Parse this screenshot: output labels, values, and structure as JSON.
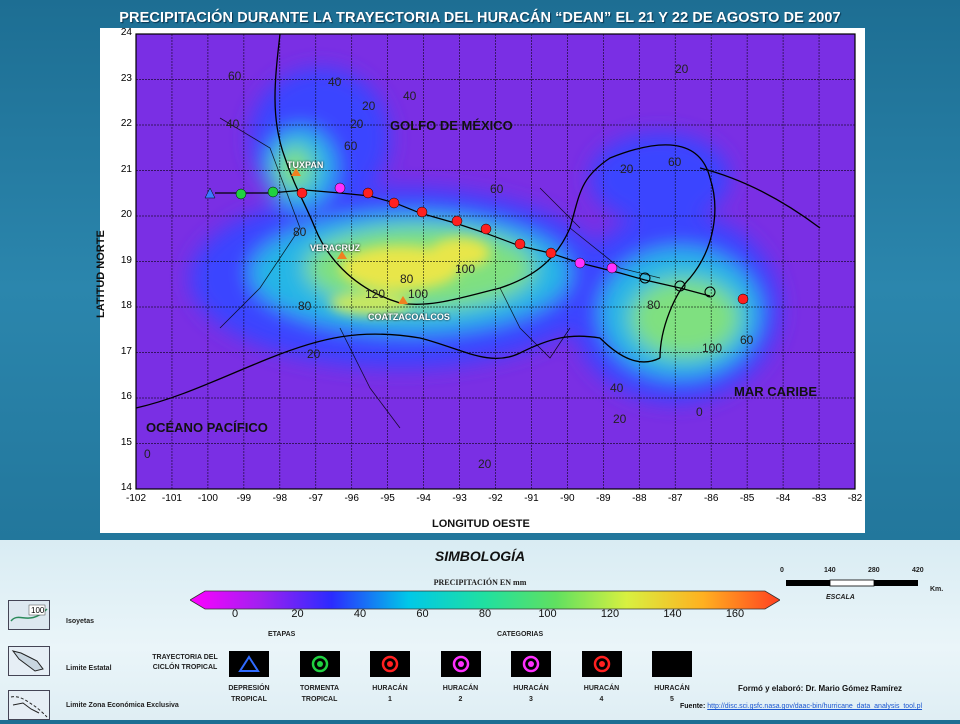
{
  "title": "PRECIPITACIÓN DURANTE LA TRAYECTORIA DEL HURACÁN “DEAN” EL 21 Y 22 DE AGOSTO DE 2007",
  "map": {
    "lat_ticks": [
      "24",
      "23",
      "22",
      "21",
      "20",
      "19",
      "18",
      "17",
      "16",
      "15",
      "14"
    ],
    "lon_ticks": [
      "-102",
      "-101",
      "-100",
      "-99",
      "-98",
      "-97",
      "-96",
      "-95",
      "-94",
      "-93",
      "-92",
      "-91",
      "-90",
      "-89",
      "-88",
      "-87",
      "-86",
      "-85",
      "-84",
      "-83",
      "-82"
    ],
    "ylabel": "LATITUD NORTE",
    "xlabel": "LONGITUD OESTE",
    "places": {
      "tuxpan": "TUXPAN",
      "veracruz": "VERACRUZ",
      "coatzacoalcos": "COATZACOALCOS"
    },
    "seas": {
      "golfo": "GOLFO DE MÉXICO",
      "caribe": "MAR CARIBE",
      "pacifico": "OCÉANO PACÍFICO"
    },
    "isoline_labels": [
      "60",
      "40",
      "40",
      "20",
      "20",
      "60",
      "80",
      "100",
      "80",
      "100",
      "120",
      "80",
      "20",
      "40",
      "60",
      "20",
      "100",
      "80",
      "60",
      "20",
      "40",
      "20",
      "0",
      "0",
      "20",
      "60"
    ],
    "colors": {
      "background": "#7a2fe4",
      "low": "#3b44ff",
      "mid": "#28b6e6",
      "high": "#7fe080",
      "peak": "#e8e64a"
    }
  },
  "legend": {
    "heading": "SIMBOLOGÍA",
    "precip_title": "PRECIPITACIÓN EN mm",
    "colorbar_ticks": [
      "0",
      "20",
      "40",
      "60",
      "80",
      "100",
      "120",
      "140",
      "160"
    ],
    "colorbar_colors": [
      "#ff00ff",
      "#a020f0",
      "#2b2bff",
      "#00c8e8",
      "#20e0a0",
      "#60e060",
      "#d8f040",
      "#ffb020",
      "#ff4020"
    ],
    "etapas": "ETAPAS",
    "categorias": "CATEGORIAS",
    "trayectoria": "TRAYECTORIA DEL CICLÓN TROPICAL",
    "isoyetas": "Isoyetas",
    "limite_estatal": "Limite Estatal",
    "limite_zee": "Limite Zona Económica Exclusiva",
    "stages": [
      {
        "line1": "DEPRESIÓN",
        "line2": "TROPICAL",
        "icon": "triangle-icon",
        "color": "#2f6bff"
      },
      {
        "line1": "TORMENTA",
        "line2": "TROPICAL",
        "icon": "storm-icon",
        "color": "#20d040"
      },
      {
        "line1": "HURACÁN",
        "line2": "1",
        "icon": "hurricane-1-icon",
        "color": "#ff2020"
      },
      {
        "line1": "HURACÁN",
        "line2": "2",
        "icon": "hurricane-2-icon",
        "color": "#ff30ff"
      },
      {
        "line1": "HURACÁN",
        "line2": "3",
        "icon": "hurricane-3-icon",
        "color": "#ff30ff"
      },
      {
        "line1": "HURACÁN",
        "line2": "4",
        "icon": "hurricane-4-icon",
        "color": "#ff2020"
      },
      {
        "line1": "HURACÁN",
        "line2": "5",
        "icon": "hurricane-5-icon",
        "color": "#000000"
      }
    ],
    "scale": {
      "ticks": [
        "0",
        "140",
        "280",
        "420"
      ],
      "unit": "Km.",
      "label": "ESCALA"
    },
    "credits": "Formó y elaboró: Dr. Mario Gómez Ramírez",
    "fuente_label": "Fuente:",
    "fuente_link": "http://disc.sci.gsfc.nasa.gov/daac-bin/hurricane_data_analysis_tool.pl"
  }
}
